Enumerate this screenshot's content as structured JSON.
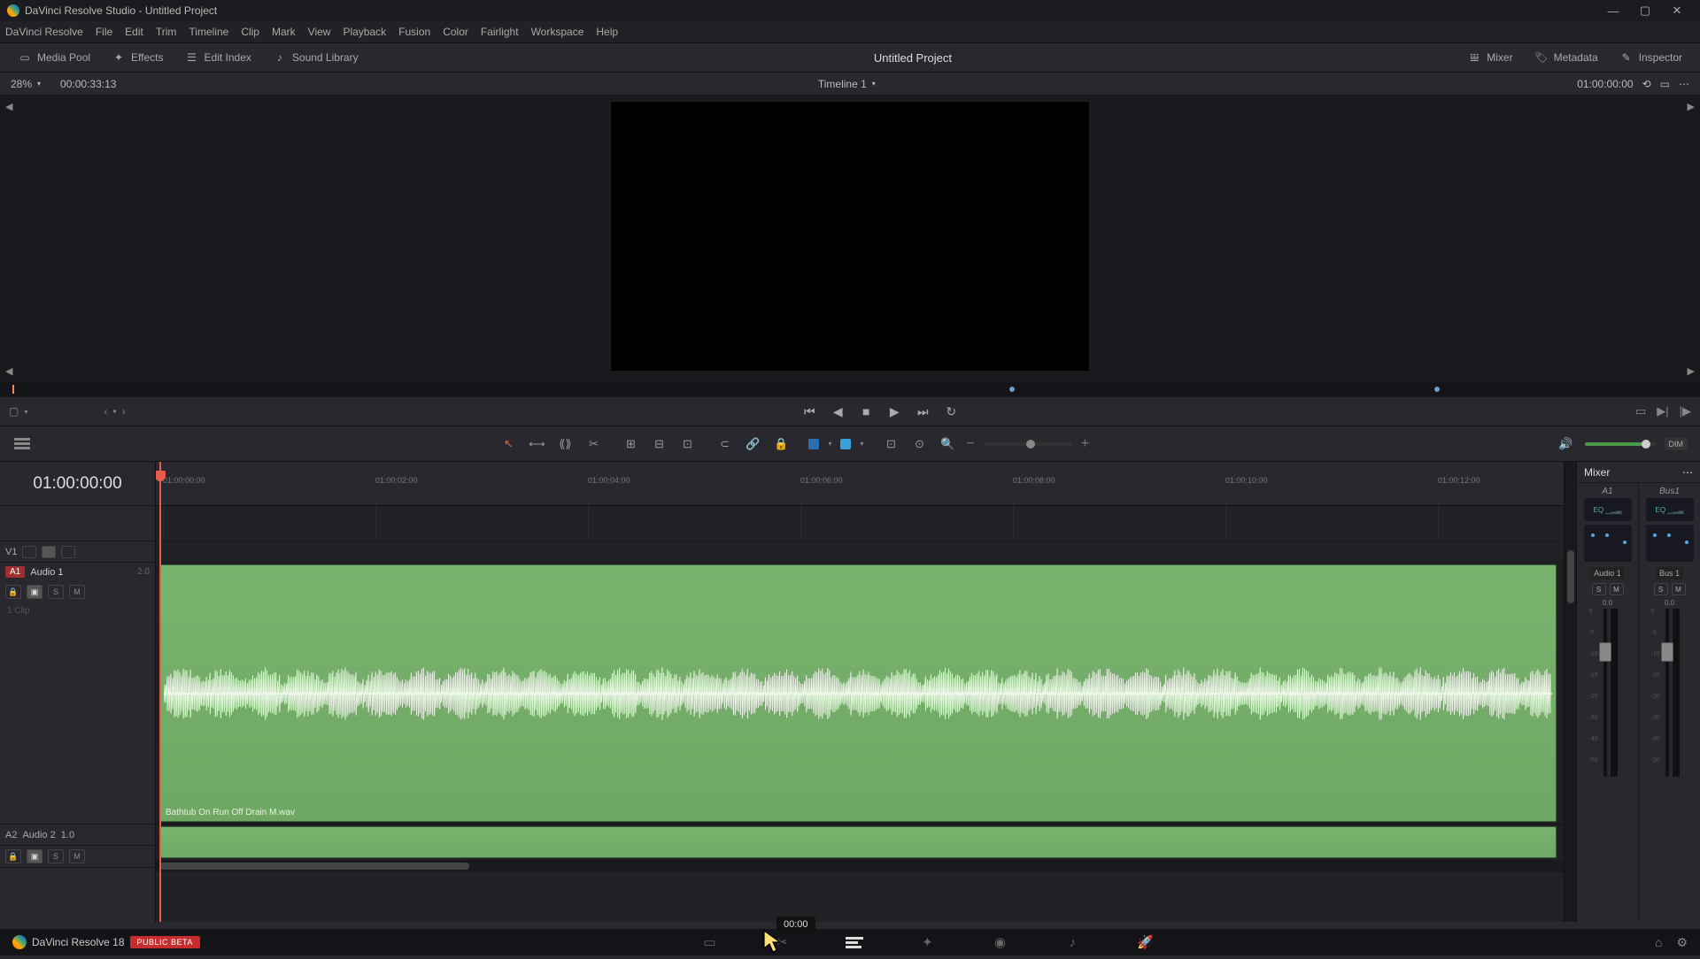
{
  "window": {
    "title": "DaVinci Resolve Studio - Untitled Project"
  },
  "menu": [
    "DaVinci Resolve",
    "File",
    "Edit",
    "Trim",
    "Timeline",
    "Clip",
    "Mark",
    "View",
    "Playback",
    "Fusion",
    "Color",
    "Fairlight",
    "Workspace",
    "Help"
  ],
  "panels": {
    "left": [
      {
        "icon": "media-pool",
        "label": "Media Pool"
      },
      {
        "icon": "fx",
        "label": "Effects"
      },
      {
        "icon": "list",
        "label": "Edit Index"
      },
      {
        "icon": "music",
        "label": "Sound Library"
      }
    ],
    "project_title": "Untitled Project",
    "right": [
      {
        "icon": "sliders",
        "label": "Mixer"
      },
      {
        "icon": "tag",
        "label": "Metadata"
      },
      {
        "icon": "tool",
        "label": "Inspector"
      }
    ]
  },
  "viewer": {
    "zoom": "28%",
    "duration_tc": "00:00:33:13",
    "timeline_name": "Timeline 1",
    "record_tc": "01:00:00:00"
  },
  "timeline": {
    "big_tc": "01:00:00:00",
    "ruler_ticks": [
      "01:00:00:00",
      "01:00:02:00",
      "01:00:04:00",
      "01:00:06:00",
      "01:00:08:00",
      "01:00:10:00",
      "01:00:12:00"
    ],
    "tracks": {
      "v1": {
        "name": "V1"
      },
      "a1": {
        "tag": "A1",
        "name": "Audio 1",
        "channels": "2.0",
        "clip_count": "1 Clip",
        "clip_name": "Bathtub On Run Off Drain M.wav"
      },
      "a2": {
        "tag": "A2",
        "name": "Audio 2",
        "channels": "1.0"
      }
    }
  },
  "mixer": {
    "title": "Mixer",
    "channels": [
      {
        "id": "A1",
        "name": "Audio 1",
        "eq": "EQ",
        "db": "0.0"
      },
      {
        "id": "Bus1",
        "name": "Bus 1",
        "eq": "EQ",
        "db": "0.0"
      }
    ],
    "fader_scale": [
      "0",
      "-5",
      "-10",
      "-15",
      "-20",
      "-30",
      "-40",
      "-50"
    ]
  },
  "toolbar": {
    "dim": "DIM"
  },
  "tooltip": {
    "text": "00:00"
  },
  "footer": {
    "app": "DaVinci Resolve 18",
    "badge": "PUBLIC BETA"
  }
}
